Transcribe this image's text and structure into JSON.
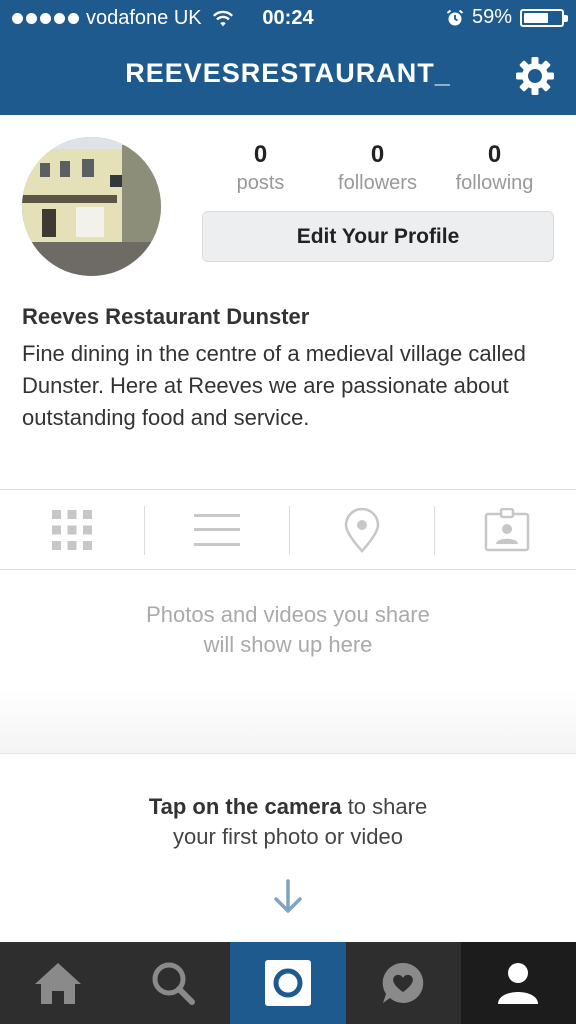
{
  "status_bar": {
    "carrier": "vodafone UK",
    "time": "00:24",
    "battery": "59%"
  },
  "nav": {
    "title": "REEVESRESTAURANT_"
  },
  "profile": {
    "stats": [
      {
        "value": "0",
        "label": "posts"
      },
      {
        "value": "0",
        "label": "followers"
      },
      {
        "value": "0",
        "label": "following"
      }
    ],
    "edit_label": "Edit Your Profile",
    "name": "Reeves Restaurant Dunster",
    "bio": "Fine dining in the centre of a medieval village called Dunster. Here at Reeves we are passionate about outstanding food and service."
  },
  "empty_state": {
    "line1": "Photos and videos you share",
    "line2": "will show up here"
  },
  "hint": {
    "bold": "Tap on the camera",
    "rest1": " to share",
    "line2": "your first photo or video"
  },
  "colors": {
    "brand": "#1e5a8e",
    "bottom_bar": "#2e2e2e"
  }
}
